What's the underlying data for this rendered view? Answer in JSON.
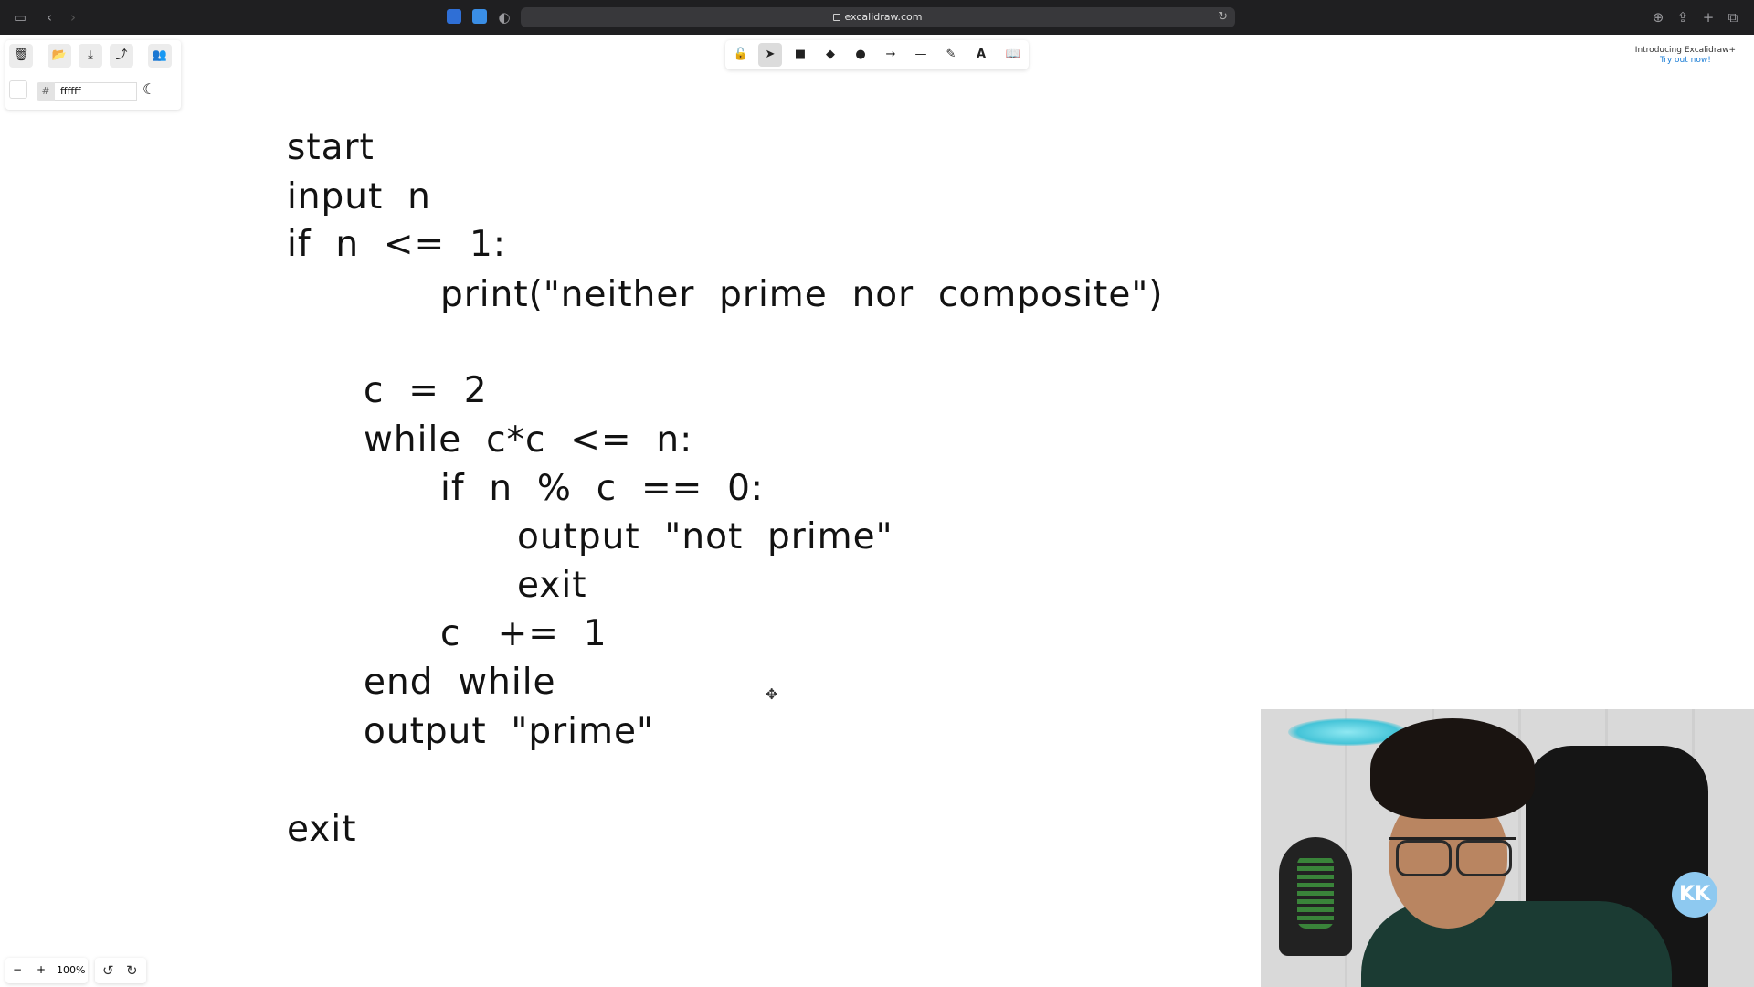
{
  "browser": {
    "url": "excalidraw.com"
  },
  "toolbar": {
    "color_hex": "ffffff",
    "hash_symbol": "#"
  },
  "promo": {
    "line1": "Introducing Excalidraw+",
    "line2": "Try out now!"
  },
  "canvas": {
    "lines": [
      "start",
      "input  n",
      "if  n  <=  1:",
      "print(\"neither  prime  nor  composite\")",
      "c  =  2",
      "while  c*c  <=  n:",
      "if  n  %  c  ==  0:",
      "output  \"not  prime\"",
      "exit",
      "c   +=  1",
      "end  while",
      "output  \"prime\"",
      "exit"
    ]
  },
  "zoom": {
    "minus": "−",
    "plus": "+",
    "level": "100%"
  },
  "webcam": {
    "badge_text": "KK"
  }
}
